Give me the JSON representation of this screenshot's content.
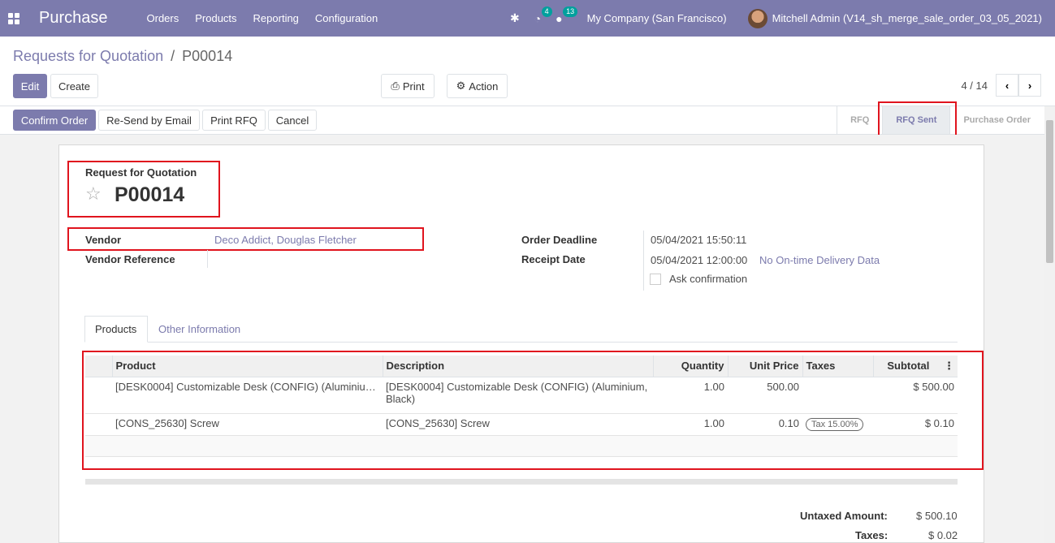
{
  "navbar": {
    "brand": "Purchase",
    "menu": [
      "Orders",
      "Products",
      "Reporting",
      "Configuration"
    ],
    "activity_count": "4",
    "messages_count": "13",
    "company": "My Company (San Francisco)",
    "user": "Mitchell Admin (V14_sh_merge_sale_order_03_05_2021)"
  },
  "breadcrumb": {
    "parent": "Requests for Quotation",
    "sep": "/",
    "current": "P00014"
  },
  "toolbar": {
    "edit": "Edit",
    "create": "Create",
    "print": "Print",
    "action": "Action"
  },
  "pager": {
    "value": "4 / 14"
  },
  "statusbar": {
    "buttons": [
      "Confirm Order",
      "Re-Send by Email",
      "Print RFQ",
      "Cancel"
    ],
    "stages": [
      "RFQ",
      "RFQ Sent",
      "Purchase Order"
    ],
    "active_stage": "RFQ Sent"
  },
  "form": {
    "doc_type": "Request for Quotation",
    "name": "P00014",
    "vendor_label": "Vendor",
    "vendor_value": "Deco Addict, Douglas Fletcher",
    "vendor_ref_label": "Vendor Reference",
    "order_deadline_label": "Order Deadline",
    "order_deadline_value": "05/04/2021 15:50:11",
    "receipt_date_label": "Receipt Date",
    "receipt_date_value": "05/04/2021 12:00:00",
    "on_time_link": "No On-time Delivery Data",
    "ask_confirmation": "Ask confirmation"
  },
  "tabs": [
    "Products",
    "Other Information"
  ],
  "lines": {
    "headers": [
      "Product",
      "Description",
      "Quantity",
      "Unit Price",
      "Taxes",
      "Subtotal"
    ],
    "rows": [
      {
        "product": "[DESK0004] Customizable Desk (CONFIG) (Aluminiu…",
        "description": "[DESK0004] Customizable Desk (CONFIG) (Aluminium, Black)",
        "quantity": "1.00",
        "unit_price": "500.00",
        "taxes": "",
        "subtotal": "$ 500.00"
      },
      {
        "product": "[CONS_25630] Screw",
        "description": "[CONS_25630] Screw",
        "quantity": "1.00",
        "unit_price": "0.10",
        "taxes": "Tax 15.00%",
        "subtotal": "$ 0.10"
      }
    ]
  },
  "totals": {
    "untaxed_label": "Untaxed Amount:",
    "untaxed_value": "$ 500.10",
    "taxes_label": "Taxes:",
    "taxes_value": "$ 0.02"
  },
  "colors": {
    "brand": "#7c7bad",
    "highlight": "#e0141e"
  }
}
